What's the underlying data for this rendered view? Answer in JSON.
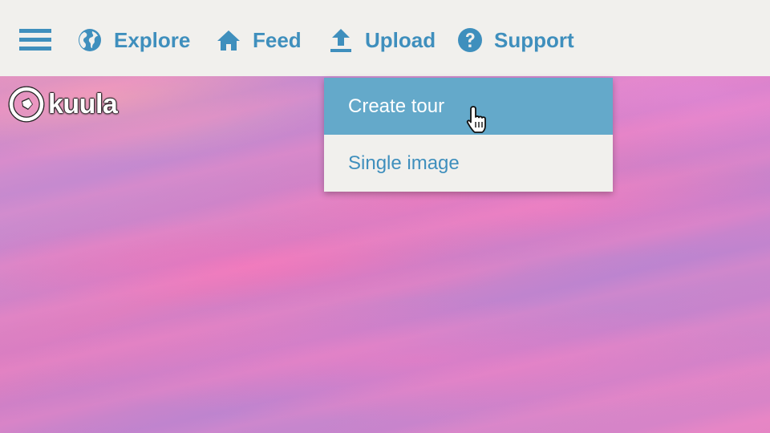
{
  "colors": {
    "accent": "#3f8fbd",
    "topbar_bg": "#f1f0ed",
    "menu_highlight": "#64a9ca"
  },
  "nav": {
    "menu_icon": "hamburger-icon",
    "items": [
      {
        "label": "Explore",
        "icon": "globe-icon"
      },
      {
        "label": "Feed",
        "icon": "home-icon"
      },
      {
        "label": "Upload",
        "icon": "upload-icon"
      },
      {
        "label": "Support",
        "icon": "question-circle-icon"
      }
    ]
  },
  "logo": {
    "text": "kuula"
  },
  "upload_menu": {
    "items": [
      {
        "label": "Create tour",
        "state": "hovered"
      },
      {
        "label": "Single image",
        "state": "normal"
      }
    ]
  }
}
